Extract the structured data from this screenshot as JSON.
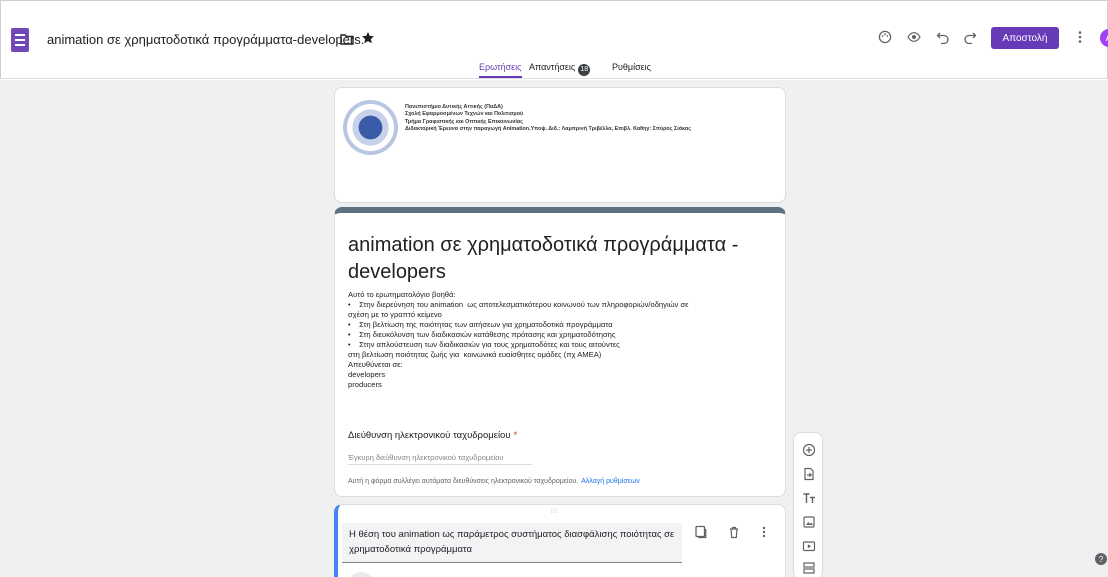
{
  "header": {
    "title": "animation σε χρηματοδοτικά προγράμματα-developers.",
    "send_label": "Αποστολή",
    "avatar_initial": "A"
  },
  "tabs": [
    {
      "label": "Ερωτήσεις",
      "active": true
    },
    {
      "label": "Απαντήσεις",
      "badge": "18"
    },
    {
      "label": "Ρυθμίσεις"
    }
  ],
  "institution": {
    "lines": [
      "Πανεπιστήμιο Δυτικής Αττικής (ΠαΔΑ)",
      "Σχολή Εφαρμοσμένων Τεχνών και Πολιτισμού",
      "Τμήμα Γραφιστικής και Οπτικής Επικοινωνίας",
      "Διδακτορική Έρευνα στην παραγωγή Animation,Υποψ. Διδ.: Λαμπρινή Τριβέλλα, Επιβλ. Καθηγ: Σπύρος Σιάκας"
    ]
  },
  "form": {
    "title": "animation σε χρηματοδοτικά προγράμματα - developers",
    "description": "Αυτό το ερωτηματολόγιο βοηθά:\n•    Στην διερεύνηση του animation  ως αποτελεσματικότερου κοινωνού των πληροφοριών/οδηγιών σε\nσχέση με το γραπτό κείμενο\n•    Στη βελτίωση της ποιότητας των αιτήσεων για χρηματοδοτικά προγράμματα\n•    Στη διευκόλυνση των διαδικασιών κατάθεσης πρότασης και χρηματοδότησης\n•    Στην απλούστευση των διαδικασιών για τους χρηματοδότες και τους αιτούντες\nστη βελτίωση ποιότητας ζωής για  κοινωνικά ευαίσθητες ομάδες (πχ ΑΜΕΑ)\nΑπευθύνεται σε:\ndevelopers\nproducers",
    "email_label": "Διεύθυνση ηλεκτρονικού ταχυδρομείου",
    "required_mark": "*",
    "email_placeholder": "Έγκυρη διεύθυνση ηλεκτρονικού ταχυδρομείου",
    "email_note": "Αυτή η φόρμα συλλέγει αυτόματα διευθύνσεις ηλεκτρονικού ταχυδρομείου.",
    "email_link": "Αλλαγή ρυθμίσεων"
  },
  "question": {
    "drag_handle": "⁝⁝⁝",
    "title": "Η θέση του animation ως παράμετρος συστήματος διασφάλισης ποιότητας σε χρηματοδοτικά προγράμματα"
  },
  "toolbar_icons": [
    "add-question-icon",
    "import-questions-icon",
    "add-title-icon",
    "add-image-icon",
    "add-video-icon",
    "add-section-icon"
  ],
  "colors": {
    "accent": "#673ab7",
    "header_bar": "#5f7180",
    "question_border": "#4285f4",
    "background": "#f0f0f0"
  }
}
